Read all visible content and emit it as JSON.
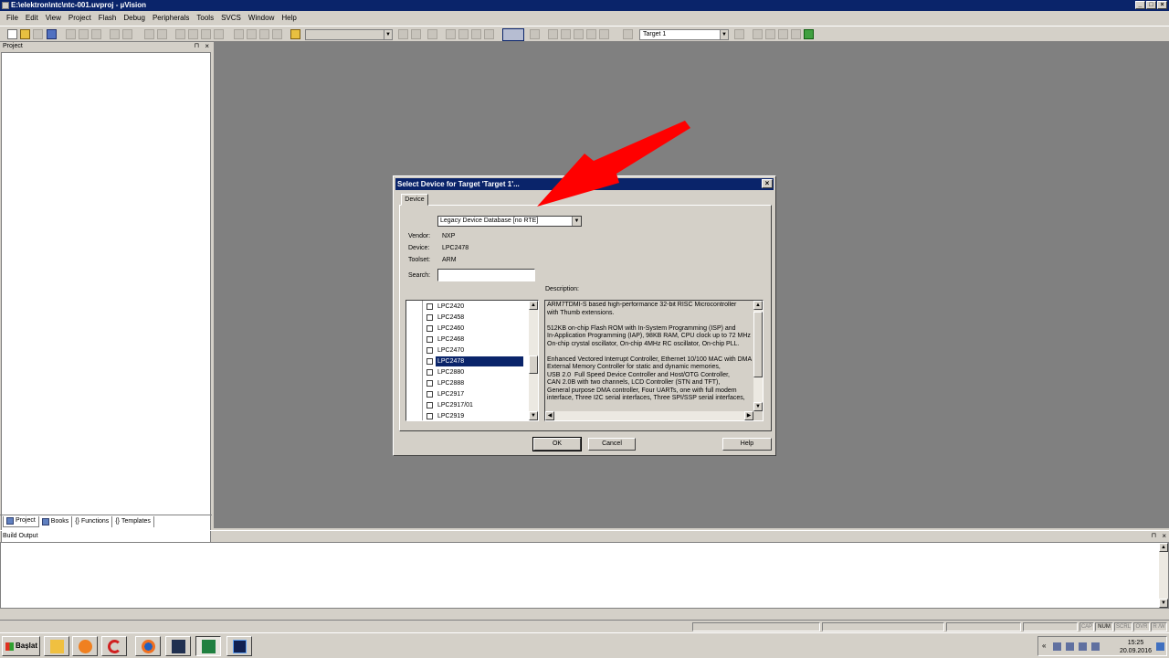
{
  "window": {
    "title": "E:\\elektron\\ntc\\ntc-001.uvproj - µVision"
  },
  "menu": [
    "File",
    "Edit",
    "View",
    "Project",
    "Flash",
    "Debug",
    "Peripherals",
    "Tools",
    "SVCS",
    "Window",
    "Help"
  ],
  "toolbar": {
    "target_combo": "Target 1"
  },
  "project_panel": {
    "title": "Project",
    "tabs": [
      "Project",
      "Books",
      "Functions",
      "Templates"
    ]
  },
  "dialog": {
    "title": "Select Device for Target 'Target 1'...",
    "tab": "Device",
    "database": "Legacy Device Database [no RTE]",
    "vendor_label": "Vendor:",
    "vendor": "NXP",
    "device_label": "Device:",
    "device": "LPC2478",
    "toolset_label": "Toolset:",
    "toolset": "ARM",
    "search_label": "Search:",
    "search_value": "",
    "description_label": "Description:",
    "devices": [
      "LPC2420",
      "LPC2458",
      "LPC2460",
      "LPC2468",
      "LPC2470",
      "LPC2478",
      "LPC2880",
      "LPC2888",
      "LPC2917",
      "LPC2917/01",
      "LPC2919"
    ],
    "selected_index": 5,
    "description": "ARM7TDMI-S based high-performance 32-bit RISC Microcontroller\nwith Thumb extensions.\n\n512KB on-chip Flash ROM with In-System Programming (ISP) and\nIn-Application Programming (IAP), 98KB RAM, CPU clock up to 72 MHz\nOn-chip crystal oscillator, On-chip 4MHz RC oscillator, On-chip PLL.\n\nEnhanced Vectored Interrupt Controller, Ethernet 10/100 MAC with DMA\nExternal Memory Controller for static and dynamic memories,\nUSB 2.0  Full Speed Device Controller and Host/OTG Controller,\nCAN 2.0B with two channels, LCD Controller (STN and TFT),\nGeneral purpose DMA controller, Four UARTs, one with full modem\ninterface, Three I2C serial interfaces, Three SPI/SSP serial interfaces,",
    "ok": "OK",
    "cancel": "Cancel",
    "help": "Help"
  },
  "build_output": {
    "title": "Build Output"
  },
  "statusbar": [
    "CAP",
    "NUM",
    "SCRL",
    "OVR",
    "R /W"
  ],
  "taskbar": {
    "start": "Başlat",
    "time": "15:25",
    "date": "20.09.2016"
  },
  "colors": {
    "titlebar": "#0a246a",
    "annotation_arrow": "#ff0000",
    "workspace": "#808080"
  }
}
